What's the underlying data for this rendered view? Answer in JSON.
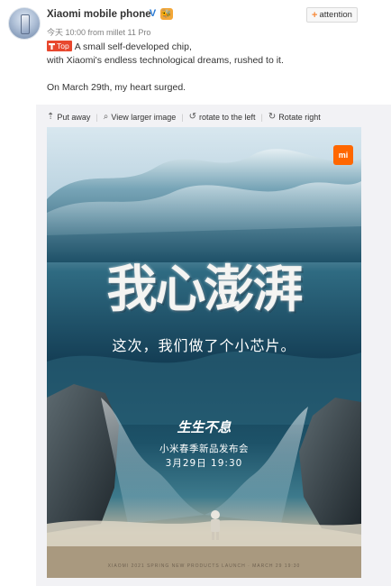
{
  "header": {
    "user_name": "Xiaomi mobile phone",
    "verified_badge": "V",
    "fans_badge": "🐝",
    "meta": "今天 10:00 from millet 11 Pro",
    "follow_label": "attention",
    "follow_plus": "+"
  },
  "post": {
    "top_tag": "Top",
    "lines": [
      "A small self-developed chip,",
      "with Xiaomi's endless technological dreams, rushed to it.",
      "On March 29th, my heart surged."
    ]
  },
  "toolbar": {
    "items": [
      {
        "icon": "upload-icon",
        "glyph": "⇡",
        "label": "Put away"
      },
      {
        "icon": "magnifier-icon",
        "glyph": "⌕",
        "label": "View larger image"
      },
      {
        "icon": "rotate-left-icon",
        "glyph": "↺",
        "label": "rotate to the left"
      },
      {
        "icon": "rotate-right-icon",
        "glyph": "↻",
        "label": "Rotate right"
      }
    ],
    "separator": "|"
  },
  "poster": {
    "brand_logo": "mi",
    "headline": "我心澎湃",
    "subline": "这次，我们做了个小芯片。",
    "event_logo": "生生不息",
    "event_name": "小米春季新品发布会",
    "event_date": "3月29日 19:30",
    "fine_print": "XIAOMI 2021 SPRING NEW PRODUCTS LAUNCH · MARCH 29 19:30",
    "colors": {
      "brand": "#ff6700",
      "sea_dark": "#143e55",
      "sea_light": "#3d7a8c",
      "sand": "#bdb39e"
    }
  }
}
